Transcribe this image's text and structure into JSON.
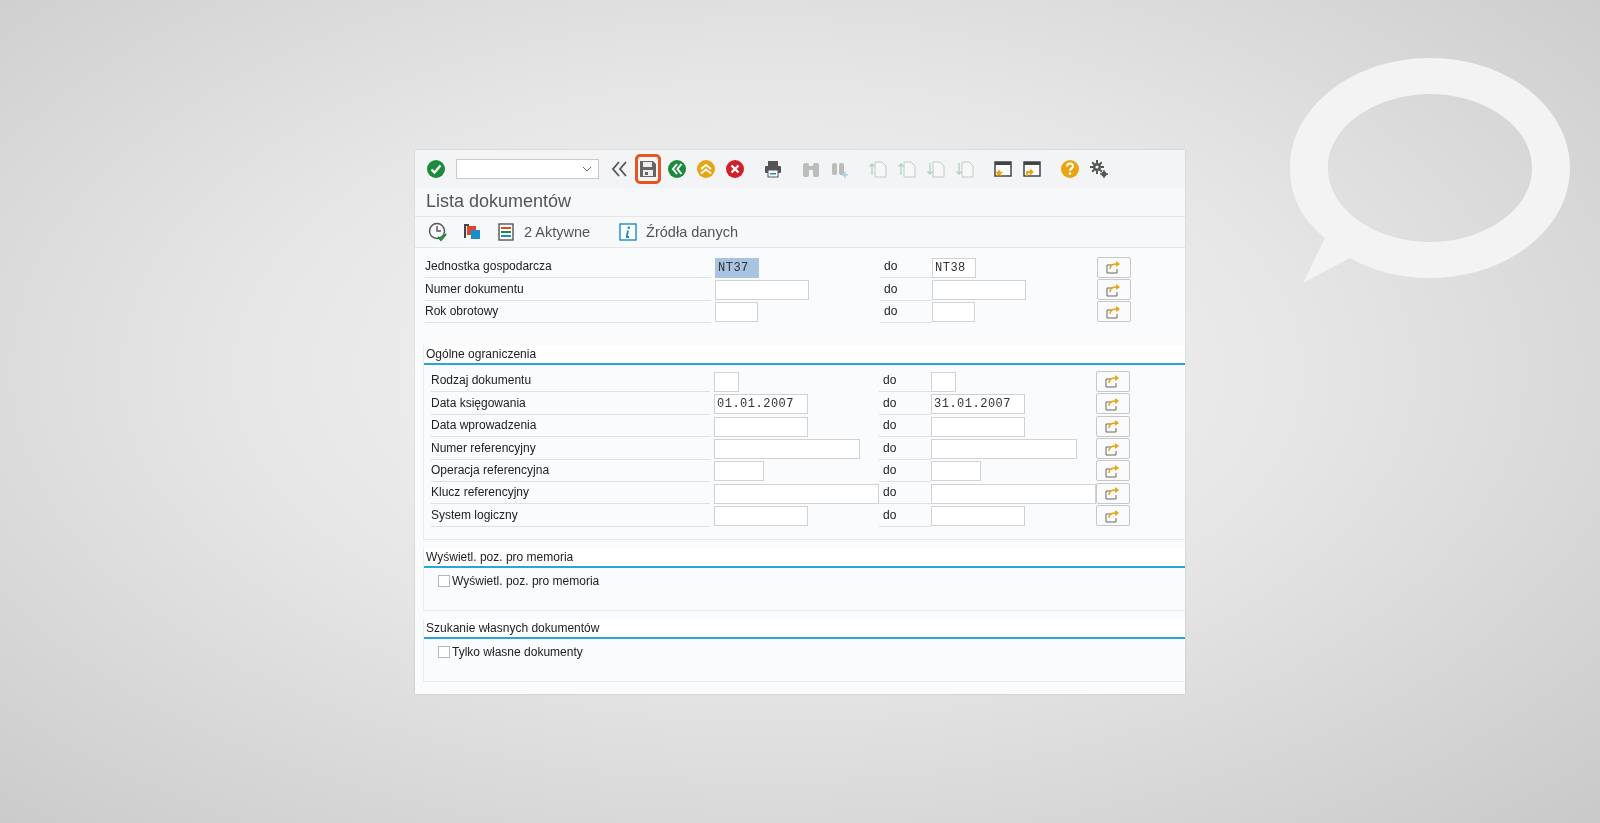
{
  "toolbar": {
    "buttons": [
      {
        "kind": "enter",
        "disabled": false,
        "highlighted": false
      },
      {
        "kind": "collapse",
        "disabled": false,
        "highlighted": false
      },
      {
        "kind": "save",
        "disabled": false,
        "highlighted": true
      },
      {
        "kind": "back",
        "disabled": false,
        "highlighted": false
      },
      {
        "kind": "exit",
        "disabled": false,
        "highlighted": false
      },
      {
        "kind": "cancel",
        "disabled": false,
        "highlighted": false
      },
      {
        "kind": "print",
        "disabled": false,
        "highlighted": false
      },
      {
        "kind": "find",
        "disabled": true,
        "highlighted": false
      },
      {
        "kind": "find_next",
        "disabled": true,
        "highlighted": false
      },
      {
        "kind": "first_page",
        "disabled": true,
        "highlighted": false
      },
      {
        "kind": "prev_page",
        "disabled": true,
        "highlighted": false
      },
      {
        "kind": "next_page",
        "disabled": true,
        "highlighted": false
      },
      {
        "kind": "last_page",
        "disabled": true,
        "highlighted": false
      },
      {
        "kind": "new_session",
        "disabled": false,
        "highlighted": false
      },
      {
        "kind": "shortcut",
        "disabled": false,
        "highlighted": false
      },
      {
        "kind": "help",
        "disabled": false,
        "highlighted": false
      },
      {
        "kind": "settings",
        "disabled": false,
        "highlighted": false
      }
    ]
  },
  "title": "Lista dokumentów",
  "app_toolbar": [
    {
      "kind": "execute"
    },
    {
      "kind": "copy"
    },
    {
      "kind": "variants",
      "label": "2 Aktywne"
    },
    {
      "kind": "info",
      "label": "Źródła danych"
    }
  ],
  "main_fields": [
    {
      "label": "Jednostka gospodarcza",
      "from": "NT37",
      "from_selected": true,
      "to_label": "do",
      "to": "NT38"
    },
    {
      "label": "Numer dokumentu",
      "from_selected": false,
      "to_label": "do"
    },
    {
      "label": "Rok obrotowy",
      "from_selected": false,
      "to_label": "do"
    }
  ],
  "sections": [
    {
      "title": "Ogólne ograniczenia",
      "fields": [
        {
          "label": "Rodzaj dokumentu",
          "from_selected": false,
          "to_label": "do"
        },
        {
          "label": "Data księgowania",
          "from": "01.01.2007",
          "from_selected": false,
          "to_label": "do",
          "to": "31.01.2007"
        },
        {
          "label": "Data wprowadzenia",
          "from_selected": false,
          "to_label": "do"
        },
        {
          "label": "Numer referencyjny",
          "from_selected": false,
          "to_label": "do"
        },
        {
          "label": "Operacja referencyjna",
          "from_selected": false,
          "to_label": "do"
        },
        {
          "label": "Klucz referencyjny",
          "from_selected": false,
          "to_label": "do"
        },
        {
          "label": "System logiczny",
          "from_selected": false,
          "to_label": "do"
        }
      ]
    },
    {
      "title": "Wyświetl. poz. pro memoria",
      "checkboxes": [
        {
          "label": "Wyświetl. poz. pro memoria",
          "checked": false
        }
      ]
    },
    {
      "title": "Szukanie własnych dokumentów",
      "checkboxes": [
        {
          "label": "Tylko własne dokumenty",
          "checked": false
        }
      ]
    }
  ]
}
